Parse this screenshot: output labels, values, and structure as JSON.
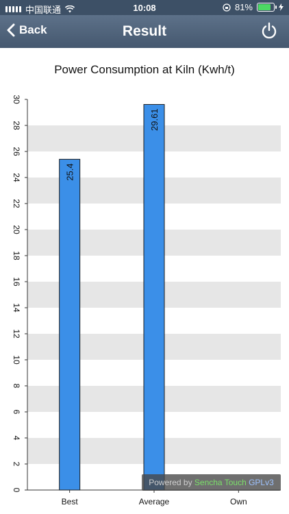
{
  "status_bar": {
    "carrier": "中国联通",
    "time": "10:08",
    "battery_percent": "81%",
    "battery_level": 0.81
  },
  "navbar": {
    "back_label": "Back",
    "title": "Result"
  },
  "chart_data": {
    "type": "bar",
    "title": "Power Consumption at Kiln (Kwh/t)",
    "categories": [
      "Best",
      "Average",
      "Own"
    ],
    "values": [
      25.4,
      29.61,
      null
    ],
    "data_labels": [
      "25.4",
      "29.61",
      ""
    ],
    "ylim": [
      0,
      30
    ],
    "yticks": [
      0,
      2,
      4,
      6,
      8,
      10,
      12,
      14,
      16,
      18,
      20,
      22,
      24,
      26,
      28,
      30
    ],
    "grid": true,
    "bar_color": "#3b8fe8",
    "band_color": "#e6e6e6",
    "xlabel": "",
    "ylabel": ""
  },
  "footer": {
    "powered_prefix": "Powered by ",
    "powered_brand": "Sencha Touch",
    "powered_license": "GPLv3"
  }
}
